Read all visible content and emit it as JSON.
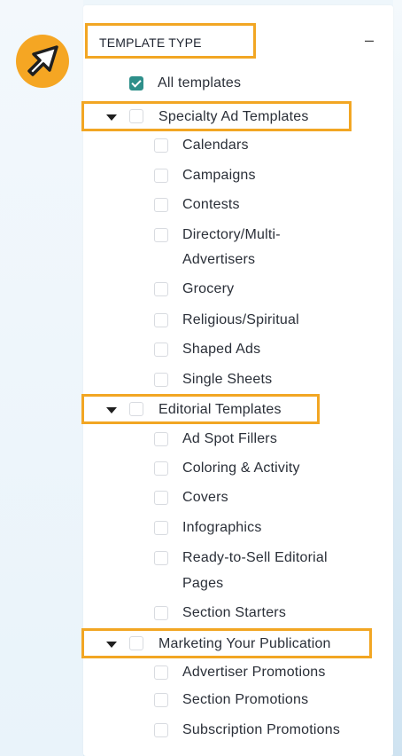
{
  "filter": {
    "header_title": "TEMPLATE TYPE",
    "collapse_symbol": "–",
    "all_templates": {
      "label": "All templates",
      "checked": true
    },
    "groups": [
      {
        "label": "Specialty Ad Templates",
        "items": [
          "Calendars",
          "Campaigns",
          "Contests",
          "Directory/Multi-",
          "Advertisers",
          "Grocery",
          "Religious/Spiritual",
          "Shaped Ads",
          "Single Sheets"
        ]
      },
      {
        "label": "Editorial Templates",
        "items": [
          "Ad Spot Fillers",
          "Coloring & Activity",
          "Covers",
          "Infographics",
          "Ready-to-Sell Editorial",
          "Pages",
          "Section Starters"
        ]
      },
      {
        "label": "Marketing Your Publication",
        "items": [
          "Advertiser Promotions",
          "Section Promotions",
          "Subscription Promotions"
        ]
      }
    ]
  },
  "colors": {
    "highlight": "#f2a623",
    "check_fill": "#2e8f8a",
    "badge": "#f5a623"
  },
  "icons": {
    "cursor": "cursor-arrow-icon",
    "caret": "caret-down-icon"
  }
}
